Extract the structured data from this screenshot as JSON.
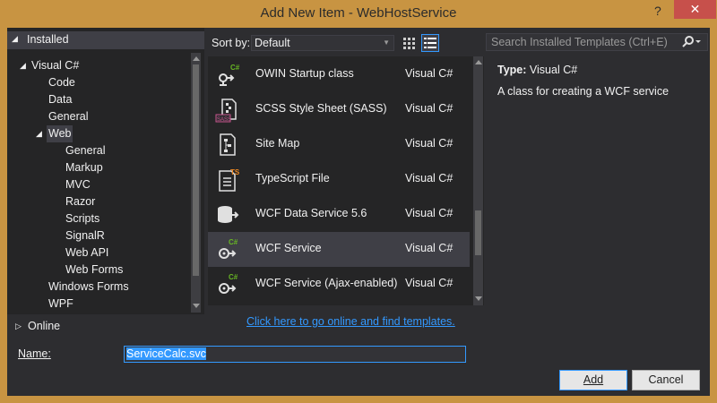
{
  "window": {
    "title": "Add New Item - WebHostService",
    "help_glyph": "?",
    "close_glyph": "✕"
  },
  "tree": {
    "installed": "Installed",
    "visual_csharp": "Visual C#",
    "items": [
      "Code",
      "Data",
      "General"
    ],
    "web": "Web",
    "web_children": [
      "General",
      "Markup",
      "MVC",
      "Razor",
      "Scripts",
      "SignalR",
      "Web API",
      "Web Forms"
    ],
    "more": [
      "Windows Forms",
      "WPF"
    ],
    "online": "Online"
  },
  "sort": {
    "label": "Sort by:",
    "value": "Default"
  },
  "templates": [
    {
      "name": "OWIN Startup class",
      "lang": "Visual C#",
      "icon": "csharp-class-icon",
      "badge": "C#"
    },
    {
      "name": "SCSS Style Sheet (SASS)",
      "lang": "Visual C#",
      "icon": "scss-file-icon",
      "badge": "SASS"
    },
    {
      "name": "Site Map",
      "lang": "Visual C#",
      "icon": "sitemap-icon",
      "badge": ""
    },
    {
      "name": "TypeScript File",
      "lang": "Visual C#",
      "icon": "typescript-file-icon",
      "badge": "TS"
    },
    {
      "name": "WCF Data Service 5.6",
      "lang": "Visual C#",
      "icon": "data-service-icon",
      "badge": ""
    },
    {
      "name": "WCF Service",
      "lang": "Visual C#",
      "icon": "wcf-service-icon",
      "badge": "C#"
    },
    {
      "name": "WCF Service (Ajax-enabled)",
      "lang": "Visual C#",
      "icon": "wcf-ajax-service-icon",
      "badge": "C#"
    }
  ],
  "online_link": "Click here to go online and find templates.",
  "search": {
    "placeholder": "Search Installed Templates (Ctrl+E)"
  },
  "details": {
    "type_label": "Type:",
    "type_value": "Visual C#",
    "description": "A class for creating a WCF service"
  },
  "form": {
    "name_label": "Name:",
    "name_value": "ServiceCalc.svc"
  },
  "buttons": {
    "add": "Add",
    "cancel": "Cancel"
  },
  "colors": {
    "accent": "#3399ff",
    "chrome": "#c89442",
    "close": "#c7504b",
    "background": "#2d2d30",
    "csharp_badge": "#68b723"
  }
}
